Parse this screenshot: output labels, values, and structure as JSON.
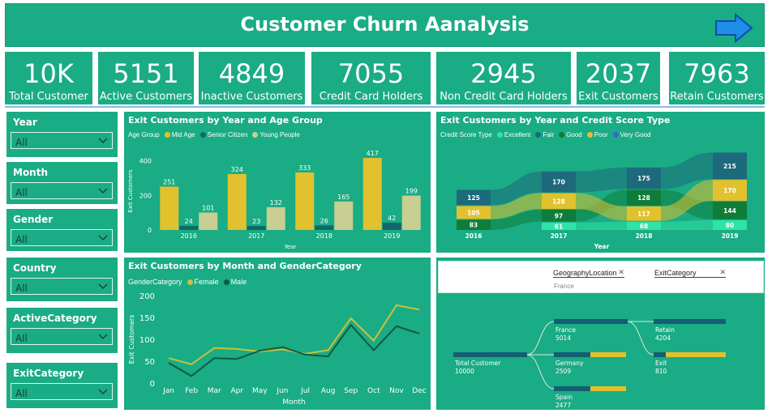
{
  "header": {
    "title": "Customer Churn Aanalysis",
    "nav_icon": "arrow-right-icon"
  },
  "kpis": [
    {
      "value": "10K",
      "label": "Total Customer"
    },
    {
      "value": "5151",
      "label": "Active Customers"
    },
    {
      "value": "4849",
      "label": "Inactive Customers"
    },
    {
      "value": "7055",
      "label": "Credit Card Holders"
    },
    {
      "value": "2945",
      "label": "Non Credit Card Holders"
    },
    {
      "value": "2037",
      "label": "Exit Customers"
    },
    {
      "value": "7963",
      "label": "Retain Customers"
    }
  ],
  "slicers": [
    {
      "label": "Year",
      "value": "All"
    },
    {
      "label": "Month",
      "value": "All"
    },
    {
      "label": "Gender",
      "value": "All"
    },
    {
      "label": "Country",
      "value": "All"
    },
    {
      "label": "ActiveCategory",
      "value": "All"
    },
    {
      "label": "ExitCategory",
      "value": "All"
    }
  ],
  "chart_data": [
    {
      "type": "bar",
      "title": "Exit Customers by Year and Age Group",
      "legend_title": "Age Group",
      "xlabel": "Year",
      "ylabel": "Exit Customers",
      "categories": [
        "2016",
        "2017",
        "2018",
        "2019"
      ],
      "yticks": [
        "0",
        "200",
        "400"
      ],
      "ylim": [
        0,
        450
      ],
      "series": [
        {
          "name": "Mid Age",
          "color": "#e2c12e",
          "values": [
            251,
            324,
            333,
            417
          ]
        },
        {
          "name": "Senior Citizen",
          "color": "#11686a",
          "values": [
            24,
            23,
            26,
            42
          ]
        },
        {
          "name": "Young People",
          "color": "#c7cf92",
          "values": [
            101,
            132,
            165,
            199
          ]
        }
      ]
    },
    {
      "type": "area",
      "title": "Exit Customers by Year and Credit Score Type",
      "legend_title": "Credit Score Type",
      "xlabel": "Year",
      "categories": [
        "2016",
        "2017",
        "2018",
        "2019"
      ],
      "series": [
        {
          "name": "Excellent",
          "color": "#2fe3a8",
          "values": [
            null,
            61,
            68,
            80
          ]
        },
        {
          "name": "Fair",
          "color": "#1d6a7c",
          "values": [
            125,
            170,
            175,
            215
          ]
        },
        {
          "name": "Good",
          "color": "#0e7d3a",
          "values": [
            83,
            97,
            128,
            144
          ]
        },
        {
          "name": "Poor",
          "color": "#e2c12e",
          "values": [
            105,
            128,
            117,
            170
          ]
        },
        {
          "name": "Very Good",
          "color": "#3d62d6",
          "values": [
            null,
            null,
            null,
            null
          ]
        }
      ]
    },
    {
      "type": "line",
      "title": "Exit Customers by Month and GenderCategory",
      "legend_title": "GenderCategory",
      "xlabel": "Month",
      "ylabel": "Exit Customers",
      "categories": [
        "Jan",
        "Feb",
        "Mar",
        "Apr",
        "May",
        "Jun",
        "Jul",
        "Aug",
        "Sep",
        "Oct",
        "Nov",
        "Dec"
      ],
      "yticks": [
        "0",
        "50",
        "100",
        "150",
        "200"
      ],
      "ylim": [
        0,
        200
      ],
      "series": [
        {
          "name": "Female",
          "color": "#c8c23a",
          "values": [
            57,
            43,
            80,
            78,
            72,
            77,
            67,
            75,
            148,
            97,
            178,
            168
          ]
        },
        {
          "name": "Male",
          "color": "#0f5a40",
          "values": [
            46,
            16,
            57,
            55,
            74,
            82,
            65,
            61,
            133,
            75,
            130,
            113
          ]
        }
      ]
    }
  ],
  "decomp": {
    "filter_1_label": "GeographyLocation",
    "filter_1_value": "France",
    "filter_2_label": "ExitCategory",
    "root": {
      "name": "Total Customer",
      "value": "10000"
    },
    "level1": [
      {
        "name": "France",
        "value": "5014"
      },
      {
        "name": "Germany",
        "value": "2509"
      },
      {
        "name": "Spain",
        "value": "2477"
      }
    ],
    "level2": [
      {
        "name": "Retain",
        "value": "4204"
      },
      {
        "name": "Exit",
        "value": "810"
      }
    ]
  }
}
